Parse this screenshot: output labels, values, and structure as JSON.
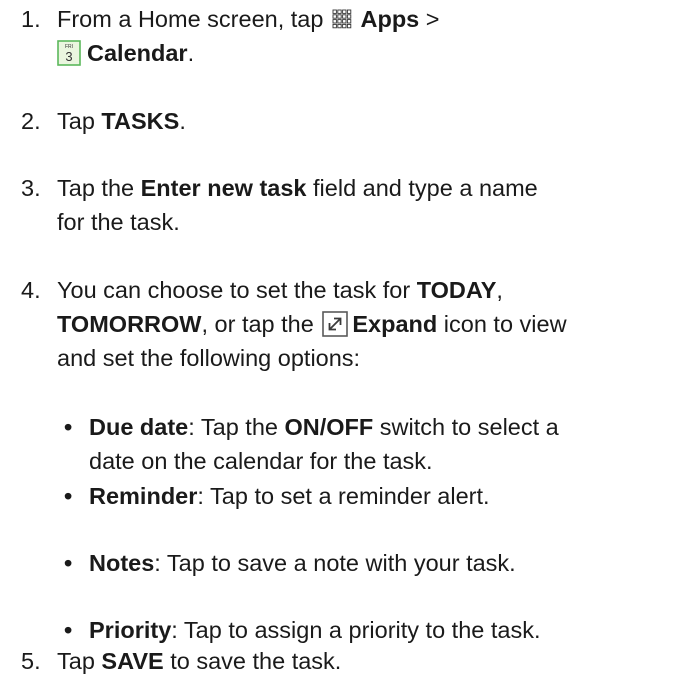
{
  "steps": [
    {
      "number": "1.",
      "line1_a": "From a Home screen, tap ",
      "apps": "Apps",
      "sep": " >",
      "calendar_icon_day": "FRI",
      "calendar_icon_date": "3",
      "calendar": "Calendar",
      "end": "."
    },
    {
      "number": "2.",
      "a": "Tap ",
      "tasks": "TASKS",
      "end": "."
    },
    {
      "number": "3.",
      "a": "Tap the ",
      "field": "Enter new task",
      "b": " field and type a name",
      "c": "for the task."
    },
    {
      "number": "4.",
      "a": "You can choose to set the task for ",
      "today": "TODAY",
      "b": ",",
      "tomorrow": "TOMORROW",
      "c": ", or tap the ",
      "expand": "Expand",
      "d": " icon to view",
      "e": "and set the following options:"
    },
    {
      "number": "5.",
      "a": "Tap ",
      "save": "SAVE",
      "b": " to save the task."
    }
  ],
  "options": [
    {
      "bullet": "•",
      "term": "Due date",
      "a": ": Tap the ",
      "switch": "ON/OFF",
      "b": " switch to select a",
      "c": "date on the calendar for the task."
    },
    {
      "bullet": "•",
      "term": "Reminder",
      "a": ": Tap to set a reminder alert."
    },
    {
      "bullet": "•",
      "term": "Notes",
      "a": ": Tap to save a note with your task."
    },
    {
      "bullet": "•",
      "term": "Priority",
      "a": ": Tap to assign a priority to the task."
    }
  ],
  "icons": {
    "apps": "apps-grid-icon",
    "calendar": "calendar-icon",
    "expand": "expand-icon"
  },
  "colors": {
    "text": "#1a1a1a",
    "calendar_icon_border": "#5cb85c",
    "calendar_icon_fill": "#eaf6df",
    "expand_icon_border": "#5a5a5a"
  }
}
